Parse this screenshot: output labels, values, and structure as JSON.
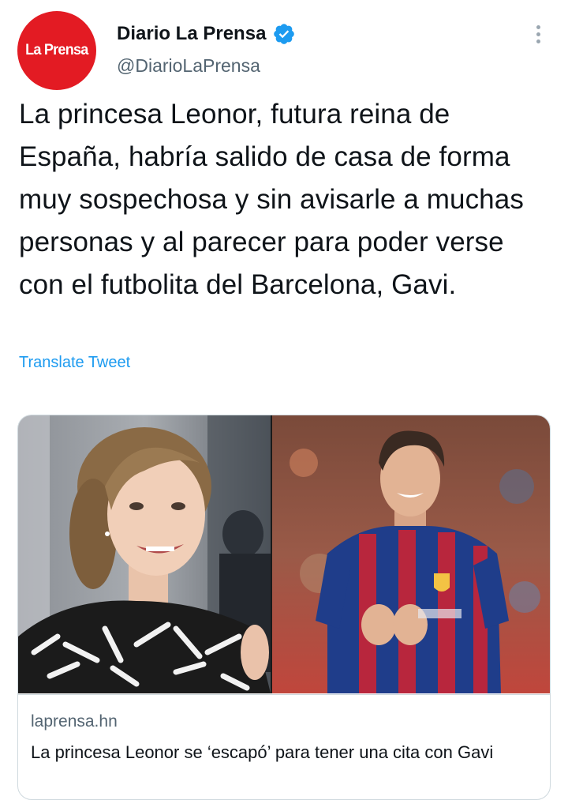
{
  "author": {
    "avatar_text": "La Prensa",
    "display_name": "Diario La Prensa",
    "handle": "@DiarioLaPrensa",
    "verified": true,
    "avatar_color": "#e31b23"
  },
  "tweet": {
    "text": "La princesa Leonor, futura reina de España, habría salido de casa de forma muy sospechosa y sin avisarle a muchas personas y al parecer para poder verse con el futbolita del Barcelona, Gavi.",
    "translate_label": "Translate Tweet"
  },
  "card": {
    "domain": "laprensa.hn",
    "title": "La princesa Leonor se ‘escapó’ para tener una cita con Gavi",
    "images": [
      "photo-princess",
      "photo-footballer"
    ]
  },
  "icons": {
    "verified": "verified-badge-icon",
    "more": "more-options-icon"
  },
  "colors": {
    "accent": "#1d9bf0",
    "secondary_text": "#536471",
    "brand_red": "#e31b23"
  }
}
